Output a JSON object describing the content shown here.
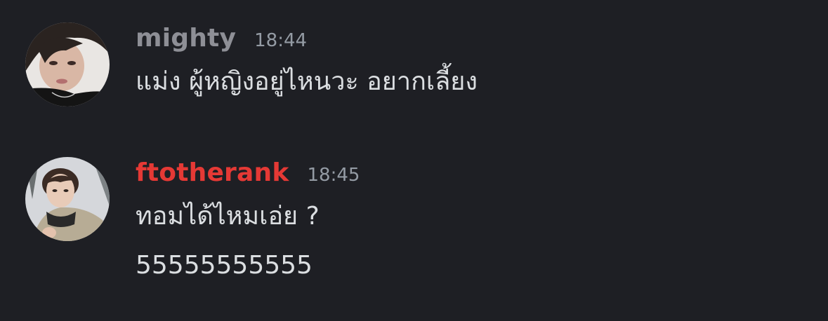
{
  "messages": [
    {
      "username": "mighty",
      "username_color": "#8e8f96",
      "timestamp": "18:44",
      "avatar": "user-avatar",
      "lines": [
        "แม่ง ผู้หญิงอยู่ไหนวะ อยากเลี้ยง"
      ]
    },
    {
      "username": "ftotherank",
      "username_color": "#e53935",
      "timestamp": "18:45",
      "avatar": "user-avatar",
      "lines": [
        "ทอมได้ไหมเอ่ย ?",
        "55555555555"
      ]
    }
  ]
}
